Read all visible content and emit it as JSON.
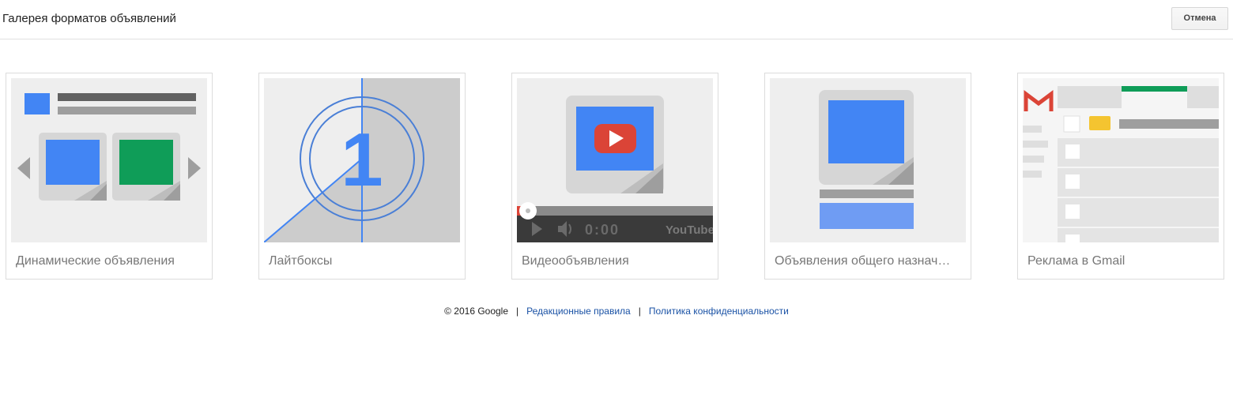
{
  "header": {
    "title": "Галерея форматов объявлений",
    "cancel_label": "Отмена"
  },
  "cards": [
    {
      "label": "Динамические объявления",
      "icon": "dynamic-ads-illustration"
    },
    {
      "label": "Лайтбоксы",
      "icon": "lightbox-illustration"
    },
    {
      "label": "Видеообъявления",
      "icon": "video-ads-illustration"
    },
    {
      "label": "Объявления общего назнач…",
      "icon": "general-ads-illustration"
    },
    {
      "label": "Реклама в Gmail",
      "icon": "gmail-ads-illustration"
    }
  ],
  "video": {
    "time": "0:00",
    "brand": "YouTube"
  },
  "lightbox": {
    "digit": "1"
  },
  "footer": {
    "copyright": "© 2016 Google",
    "separator": "|",
    "editorial_link": "Редакционные правила",
    "privacy_link": "Политика конфиденциальности"
  },
  "colors": {
    "blue": "#4285f4",
    "green": "#0f9d58",
    "red": "#db4437",
    "yellow": "#f4c430",
    "link": "#1a52a5"
  }
}
